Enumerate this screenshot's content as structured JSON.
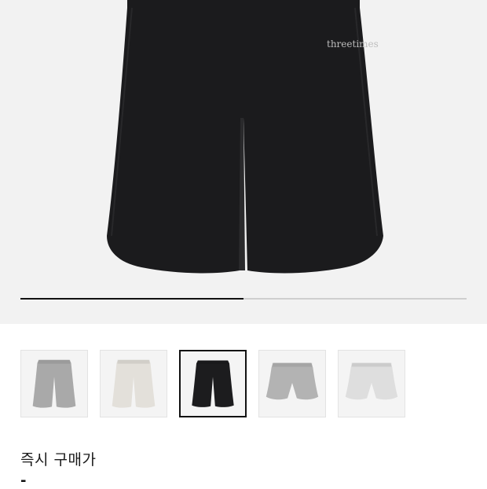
{
  "product": {
    "brand_print": "threetimes",
    "gallery": {
      "slide_progress": 0.5,
      "selected_index": 2
    },
    "thumbnails": [
      {
        "label": "gray long shorts",
        "color": "#a9a9a9",
        "style": "long"
      },
      {
        "label": "ivory long shorts",
        "color": "#e3e0da",
        "style": "long"
      },
      {
        "label": "black long shorts",
        "color": "#1c1c1e",
        "style": "long"
      },
      {
        "label": "gray short shorts",
        "color": "#b3b3b3",
        "style": "short"
      },
      {
        "label": "light gray short shorts",
        "color": "#dedede",
        "style": "short"
      }
    ],
    "price_label": "즉시 구매가",
    "price_value": "-"
  }
}
